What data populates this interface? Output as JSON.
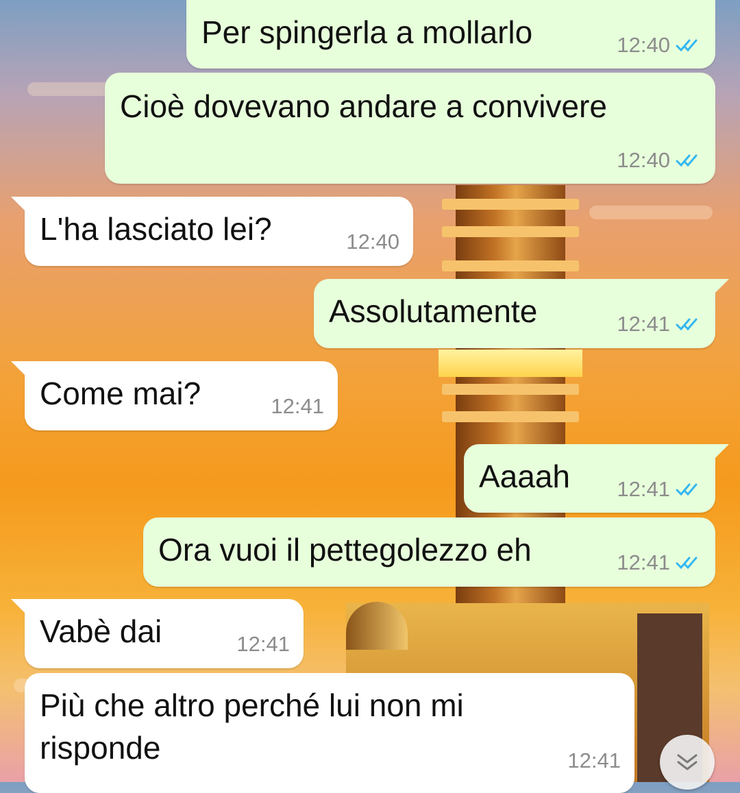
{
  "colors": {
    "outgoing_bubble": "#e7ffdb",
    "incoming_bubble": "#ffffff",
    "read_ticks": "#34b7f1",
    "timestamp": "#8c8c8c"
  },
  "messages": [
    {
      "direction": "out",
      "text": "Per spingerla a mollarlo",
      "time": "12:40",
      "status": "read"
    },
    {
      "direction": "out",
      "text": "Cioè dovevano andare a convivere",
      "time": "12:40",
      "status": "read"
    },
    {
      "direction": "in",
      "text": "L'ha lasciato lei?",
      "time": "12:40"
    },
    {
      "direction": "out",
      "text": "Assolutamente",
      "time": "12:41",
      "status": "read"
    },
    {
      "direction": "in",
      "text": "Come mai?",
      "time": "12:41"
    },
    {
      "direction": "out",
      "text": "Aaaah",
      "time": "12:41",
      "status": "read"
    },
    {
      "direction": "out",
      "text": "Ora vuoi il pettegolezzo eh",
      "time": "12:41",
      "status": "read"
    },
    {
      "direction": "in",
      "text": "Vabè dai",
      "time": "12:41"
    },
    {
      "direction": "in",
      "text_line1": "Più che altro perché lui non mi",
      "text_line2": "risponde",
      "time": "12:41"
    }
  ],
  "scroll_to_bottom": {
    "icon": "double-chevron-down-icon"
  }
}
